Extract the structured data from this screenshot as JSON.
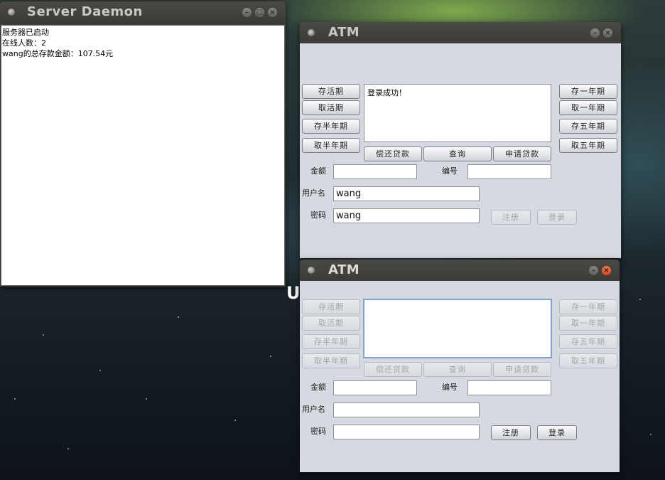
{
  "desktop": {
    "background_colors": [
      "#2d3b3a",
      "#1f2b31",
      "#0c1218",
      "#8cbe50"
    ],
    "partial_text": "U"
  },
  "server": {
    "title": "Server Daemon",
    "buttons": {
      "minimize": "–",
      "maximize": "□",
      "close": "×"
    },
    "log": [
      "服务器已启动",
      "在线人数：2",
      "wang的总存款金额：107.54元"
    ]
  },
  "atm1": {
    "title": "ATM",
    "buttons": {
      "minimize": "–",
      "close": "×"
    },
    "left": [
      "存活期",
      "取活期",
      "存半年期",
      "取半年期"
    ],
    "right": [
      "存一年期",
      "取一年期",
      "存五年期",
      "取五年期"
    ],
    "middle": [
      "偿还贷款",
      "查询",
      "申请贷款"
    ],
    "output": "登录成功！",
    "amount_label": "金额",
    "amount_value": "",
    "id_label": "编号",
    "id_value": "",
    "username_label": "用户名",
    "username_value": "wang",
    "password_label": "密码",
    "password_value": "wang",
    "register": "注册",
    "login": "登录",
    "state": "logged-in"
  },
  "atm2": {
    "title": "ATM",
    "buttons": {
      "minimize": "–",
      "close": "×"
    },
    "left": [
      "存活期",
      "取活期",
      "存半年期",
      "取半年期"
    ],
    "right": [
      "存一年期",
      "取一年期",
      "存五年期",
      "取五年期"
    ],
    "middle": [
      "偿还贷款",
      "查询",
      "申请贷款"
    ],
    "output": "",
    "amount_label": "金额",
    "amount_value": "",
    "id_label": "编号",
    "id_value": "",
    "username_label": "用户名",
    "username_value": "",
    "password_label": "密码",
    "password_value": "",
    "register": "注册",
    "login": "登录",
    "state": "logged-out"
  }
}
